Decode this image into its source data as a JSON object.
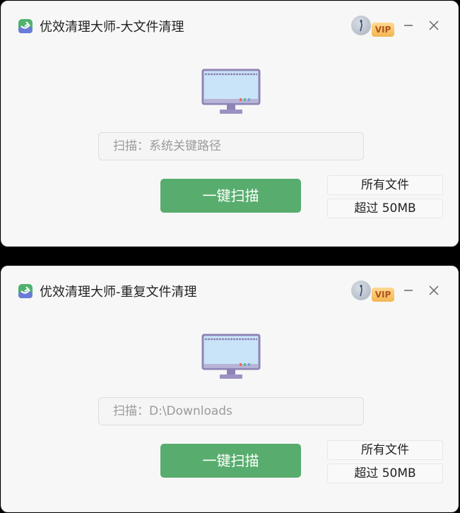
{
  "windows": [
    {
      "title": "优效清理大师-大文件清理",
      "vip_badge": "VIP",
      "scan_path": "扫描：系统关键路径",
      "scan_button": "一键扫描",
      "option_all_files": "所有文件",
      "option_size": "超过 50MB"
    },
    {
      "title": "优效清理大师-重复文件清理",
      "vip_badge": "VIP",
      "scan_path": "扫描：D:\\Downloads",
      "scan_button": "一键扫描",
      "option_all_files": "所有文件",
      "option_size": "超过 50MB"
    }
  ],
  "colors": {
    "accent": "#58ad6e",
    "window_bg": "#f7f7f7",
    "vip_gold": "#f3b54f"
  },
  "icons": [
    "app-logo-icon",
    "avatar",
    "minimize-icon",
    "close-icon",
    "monitor-icon"
  ]
}
